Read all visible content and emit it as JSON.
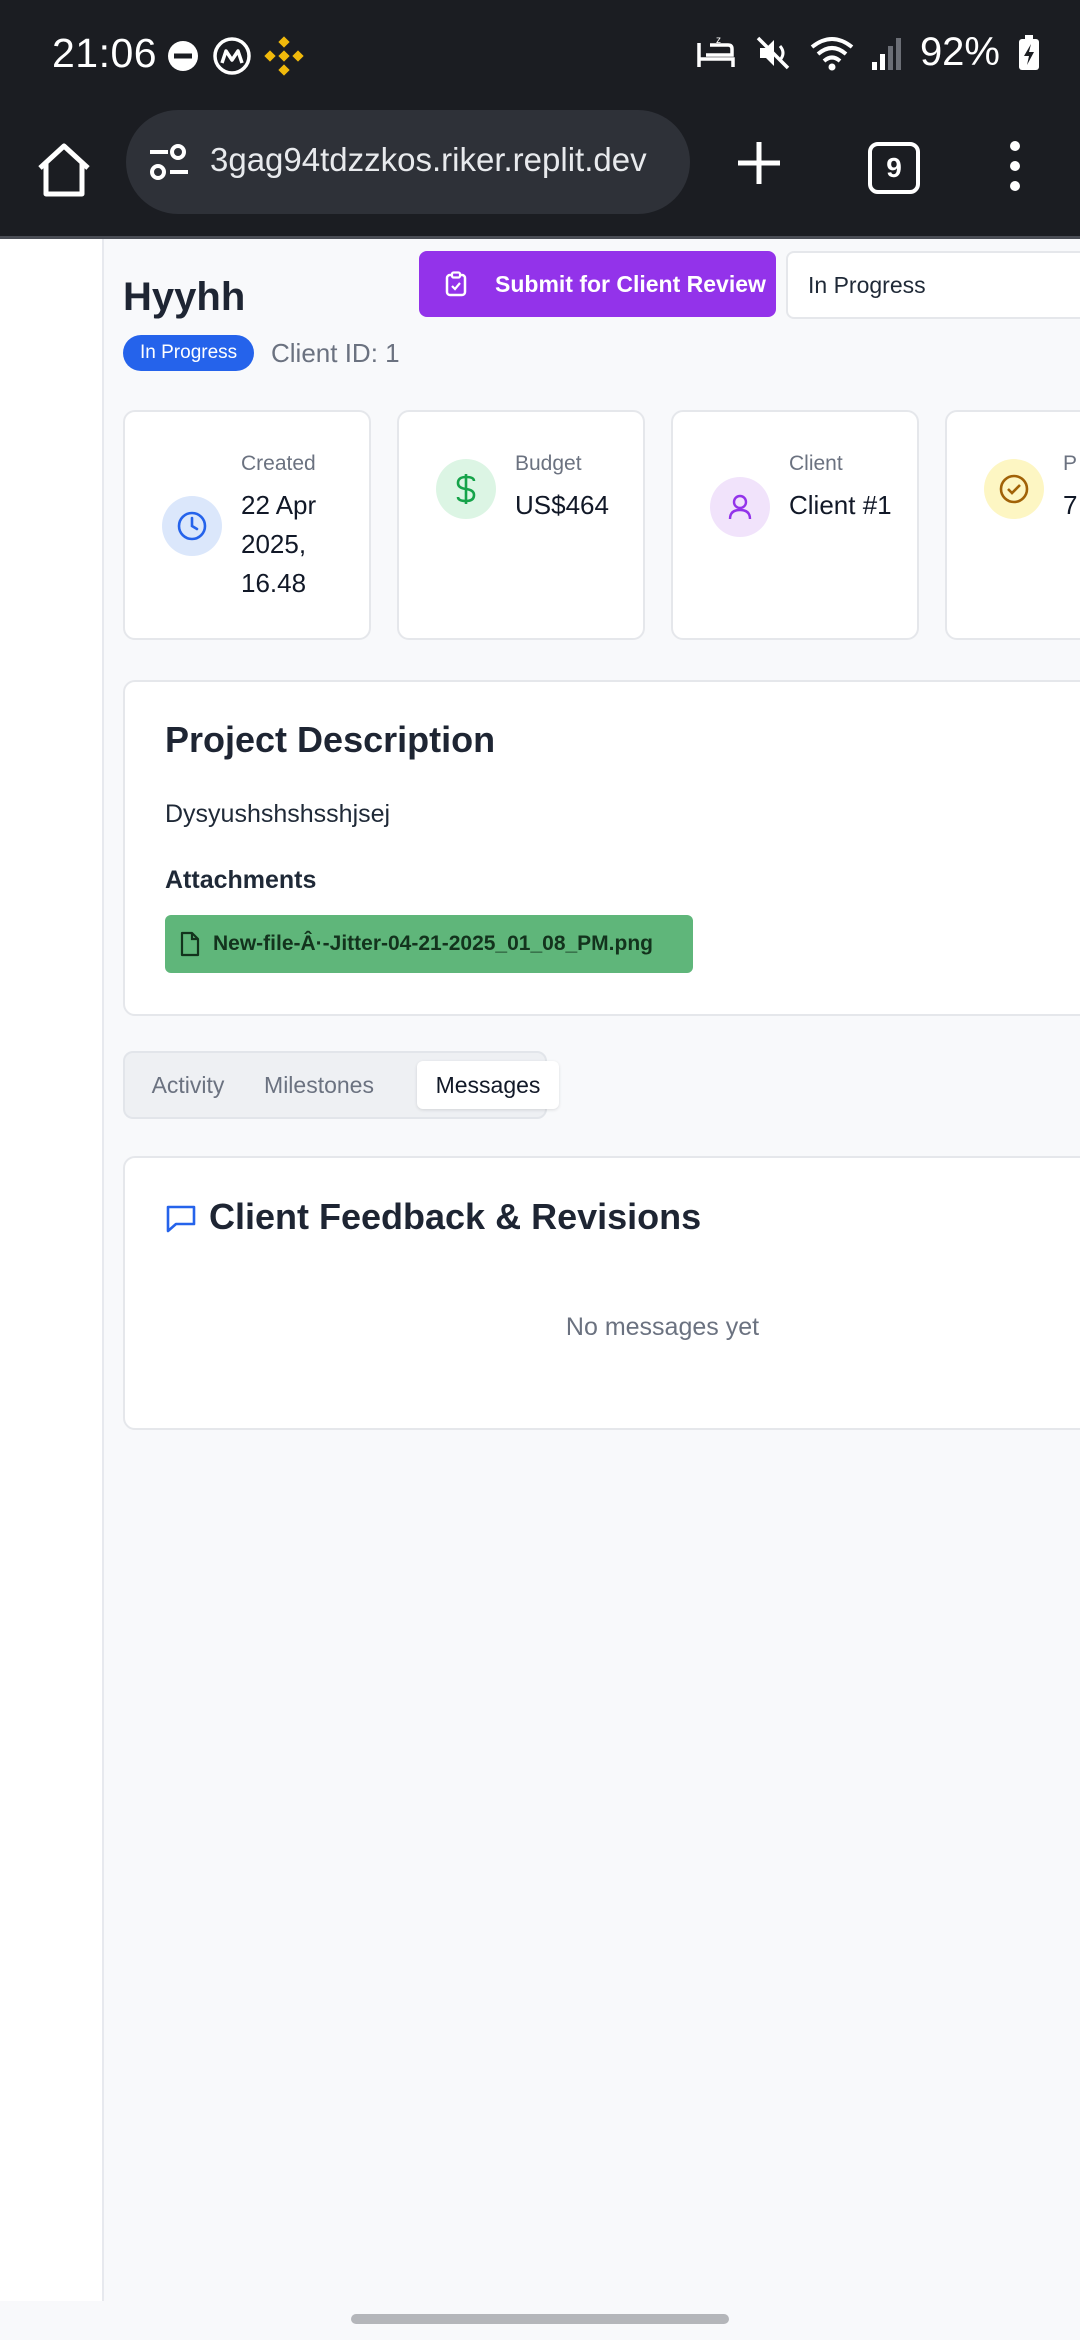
{
  "status_bar": {
    "time": "21:06",
    "battery": "92%",
    "left_icons": [
      "dnd-icon",
      "coinmarketcap-icon",
      "binance-icon"
    ],
    "right_icons": [
      "sleep-icon",
      "mute-icon",
      "wifi-icon",
      "signal-icon",
      "battery-charging-icon"
    ]
  },
  "browser": {
    "url": "3gag94tdzzkos.riker.replit.dev",
    "tab_count": "9"
  },
  "project": {
    "title": "Hyyhh",
    "status_badge": "In Progress",
    "client_id": "Client ID: 1",
    "submit_label": "Submit for Client Review",
    "status_select": "In Progress"
  },
  "stats": [
    {
      "label": "Created",
      "value": "22 Apr 2025, 16.48",
      "icon": "clock-icon",
      "color": "#2563eb",
      "bg": "#dbe7fb"
    },
    {
      "label": "Budget",
      "value": "US$464",
      "icon": "dollar-icon",
      "color": "#16a34a",
      "bg": "#dcf5e4"
    },
    {
      "label": "Client",
      "value": "Client #1",
      "icon": "user-icon",
      "color": "#9333ea",
      "bg": "#f1e3fb"
    },
    {
      "label": "P",
      "value": "7",
      "icon": "check-circle-icon",
      "color": "#a16207",
      "bg": "#fdf6c3"
    }
  ],
  "description": {
    "heading": "Project Description",
    "text": "Dysyushshshsshjsej",
    "attachments_heading": "Attachments",
    "attachment_file": "New-file-Â·-Jitter-04-21-2025_01_08_PM.png"
  },
  "tabs": [
    "Activity",
    "Milestones",
    "Messages"
  ],
  "active_tab": "Messages",
  "messages": {
    "heading": "Client Feedback & Revisions",
    "empty_text": "No messages yet"
  },
  "colors": {
    "accent_purple": "#9333ea",
    "badge_blue": "#2563eb",
    "attachment_green": "#5fb67a"
  }
}
